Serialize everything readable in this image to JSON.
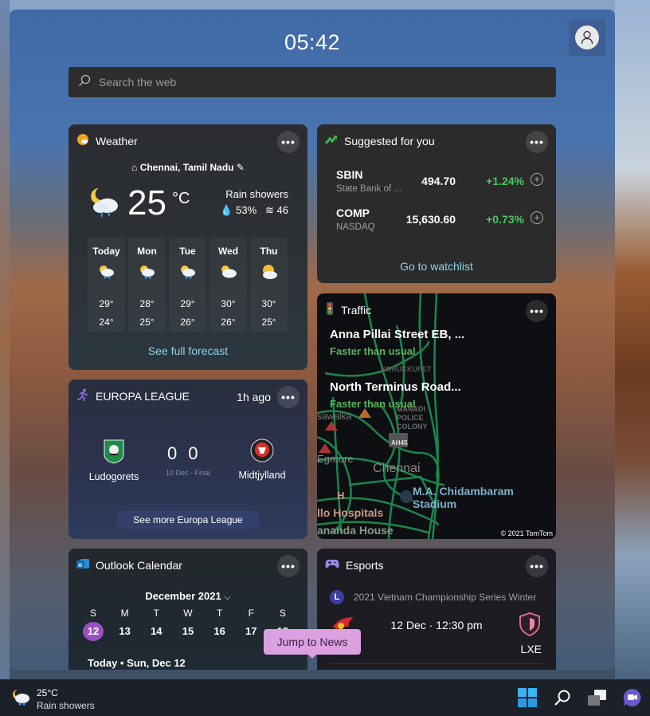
{
  "header": {
    "clock": "05:42",
    "search_placeholder": "Search the web"
  },
  "weather": {
    "title": "Weather",
    "location": "Chennai, Tamil Nadu",
    "temperature": "25",
    "unit": "°C",
    "condition": "Rain showers",
    "humidity": "53%",
    "wind": "46",
    "forecast": [
      {
        "day": "Today",
        "high": "29°",
        "low": "24°",
        "icon": "rain-partly-cloudy-icon"
      },
      {
        "day": "Mon",
        "high": "28°",
        "low": "25°",
        "icon": "rain-partly-cloudy-icon"
      },
      {
        "day": "Tue",
        "high": "29°",
        "low": "26°",
        "icon": "rain-partly-cloudy-icon"
      },
      {
        "day": "Wed",
        "high": "30°",
        "low": "26°",
        "icon": "partly-cloudy-icon"
      },
      {
        "day": "Thu",
        "high": "30°",
        "low": "25°",
        "icon": "partly-sunny-icon"
      }
    ],
    "link": "See full forecast"
  },
  "stocks": {
    "title": "Suggested for you",
    "items": [
      {
        "symbol": "SBIN",
        "name": "State Bank of ...",
        "price": "494.70",
        "change": "+1.24%"
      },
      {
        "symbol": "COMP",
        "name": "NASDAQ",
        "price": "15,630.60",
        "change": "+0.73%"
      }
    ],
    "link": "Go to watchlist",
    "positive_color": "#49c760"
  },
  "traffic": {
    "title": "Traffic",
    "routes": [
      {
        "name": "Anna Pillai Street EB, ...",
        "status": "Faster than usual"
      },
      {
        "name": "North Terminus Road...",
        "status": "Faster than usual"
      }
    ],
    "map_labels": {
      "area1": "KORUKKUPET",
      "area2": "MANADI POLICE COLONY",
      "city": "Chennai",
      "egmore": "Egmore",
      "stadium": "M.A. Chidambaram Stadium",
      "hospital": "llo Hospitals",
      "house": "ananda House",
      "highway": "AH45",
      "partial": "sawalka"
    },
    "copyright": "© 2021 TomTom"
  },
  "europa": {
    "title": "EUROPA LEAGUE",
    "time_ago": "1h ago",
    "home_team": "Ludogorets",
    "away_team": "Midtjylland",
    "home_score": "0",
    "away_score": "0",
    "match_info": "10 Dec - Final",
    "link": "See more Europa League"
  },
  "calendar": {
    "title": "Outlook Calendar",
    "month": "December 2021",
    "weekdays": [
      "S",
      "M",
      "T",
      "W",
      "T",
      "F",
      "S"
    ],
    "dates": [
      "12",
      "13",
      "14",
      "15",
      "16",
      "17",
      "18"
    ],
    "today_index": 0,
    "agenda_heading": "Today • Sun, Dec 12",
    "today_color": "#9b4fc2"
  },
  "esports": {
    "title": "Esports",
    "league_badge": "L",
    "league": "2021 Vietnam Championship Series Winter",
    "match_time": "12 Dec · 12:30 pm",
    "away_team": "LXE"
  },
  "tooltip": {
    "text": "Jump to News"
  },
  "taskbar": {
    "temperature": "25°C",
    "condition": "Rain showers"
  }
}
